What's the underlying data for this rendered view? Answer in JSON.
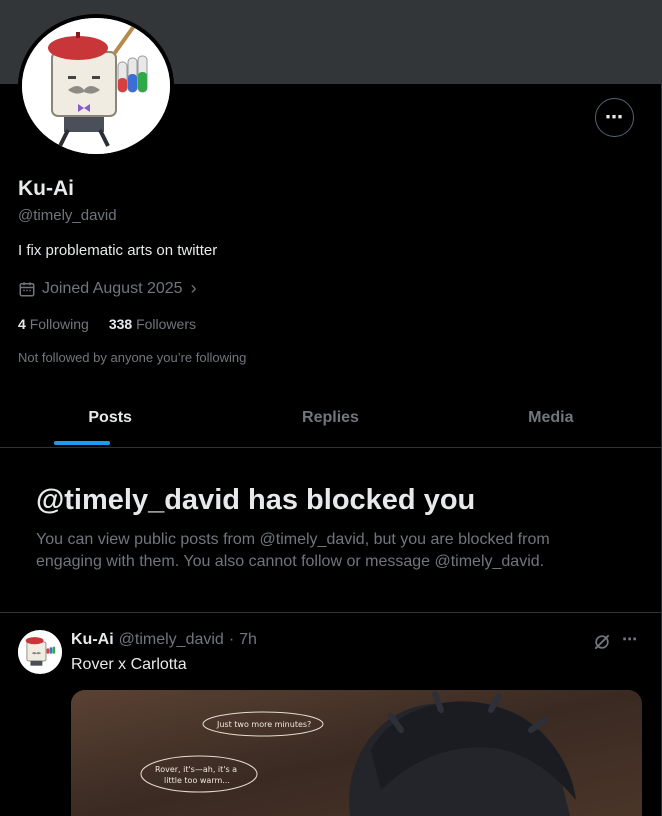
{
  "profile": {
    "name": "Ku-Ai",
    "handle": "@timely_david",
    "bio": "I fix problematic arts on twitter",
    "joined": "Joined August 2025",
    "following_count": "4",
    "following_label": "Following",
    "followers_count": "338",
    "followers_label": "Followers",
    "not_followed": "Not followed by anyone you’re following"
  },
  "tabs": [
    {
      "label": "Posts",
      "active": true
    },
    {
      "label": "Replies",
      "active": false
    },
    {
      "label": "Media",
      "active": false
    }
  ],
  "blocked": {
    "title": "@timely_david has blocked you",
    "description": "You can view public posts from @timely_david, but you are blocked from engaging with them. You also cannot follow or message @timely_david."
  },
  "post": {
    "name": "Ku-Ai",
    "handle": "@timely_david",
    "separator": "·",
    "time": "7h",
    "text": "Rover x Carlotta",
    "image_bubbles": [
      "Just two more minutes?",
      "Rover, it's—ah, it's a",
      "little too warm..."
    ]
  },
  "icons": {
    "more": "more-horizontal-icon",
    "calendar": "calendar-icon",
    "grok": "grok-icon"
  },
  "colors": {
    "accent": "#1d9bf0",
    "secondary_text": "#71767b",
    "primary_text": "#e7e9ea",
    "banner": "#333639"
  }
}
